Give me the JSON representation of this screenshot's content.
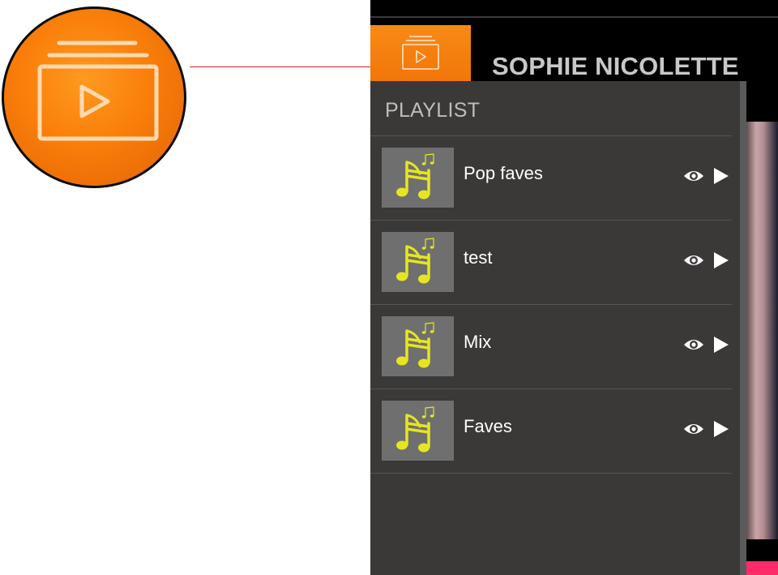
{
  "header": {
    "artist_name": "SOPHIE NICOLETTE",
    "playlist_tab_icon": "playlist-video-icon"
  },
  "callout": {
    "icon": "playlist-video-icon",
    "color": "#f97e0a",
    "arrow_color": "#e02020"
  },
  "playlist": {
    "title": "PLAYLIST",
    "thumbnail_icon": "music-note-icon",
    "item_actions": [
      "eye-icon",
      "play-icon"
    ],
    "items": [
      {
        "name": "Pop faves"
      },
      {
        "name": "test"
      },
      {
        "name": "Mix"
      },
      {
        "name": "Faves"
      }
    ]
  },
  "colors": {
    "accent": "#f97e0a",
    "panel_bg": "#3b3838",
    "thumb_bg": "#6f6f6f",
    "note": "#e6e620"
  }
}
